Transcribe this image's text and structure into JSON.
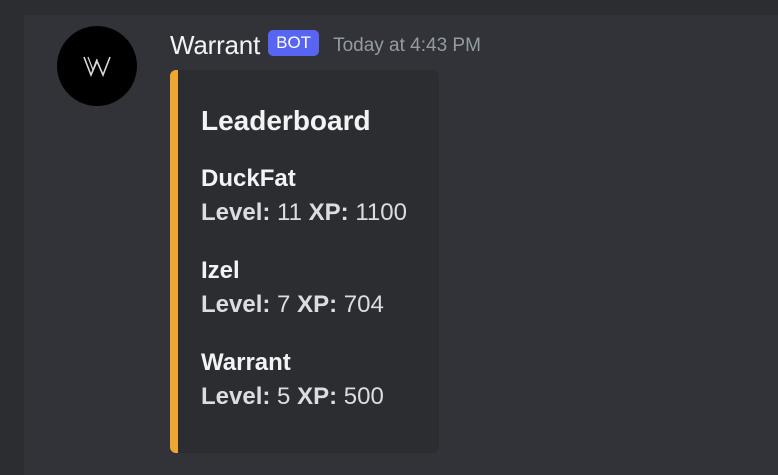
{
  "message": {
    "author": "Warrant",
    "badge": "BOT",
    "timestamp": "Today at 4:43 PM",
    "avatar_icon": "w-logo-icon",
    "avatar_color": "#000000"
  },
  "embed": {
    "accent_color": "#f0a732",
    "title": "Leaderboard",
    "level_label": "Level:",
    "xp_label": "XP:",
    "fields": [
      {
        "name": "DuckFat",
        "level": "11",
        "xp": "1100"
      },
      {
        "name": "Izel",
        "level": "7",
        "xp": "704"
      },
      {
        "name": "Warrant",
        "level": "5",
        "xp": "500"
      }
    ]
  }
}
